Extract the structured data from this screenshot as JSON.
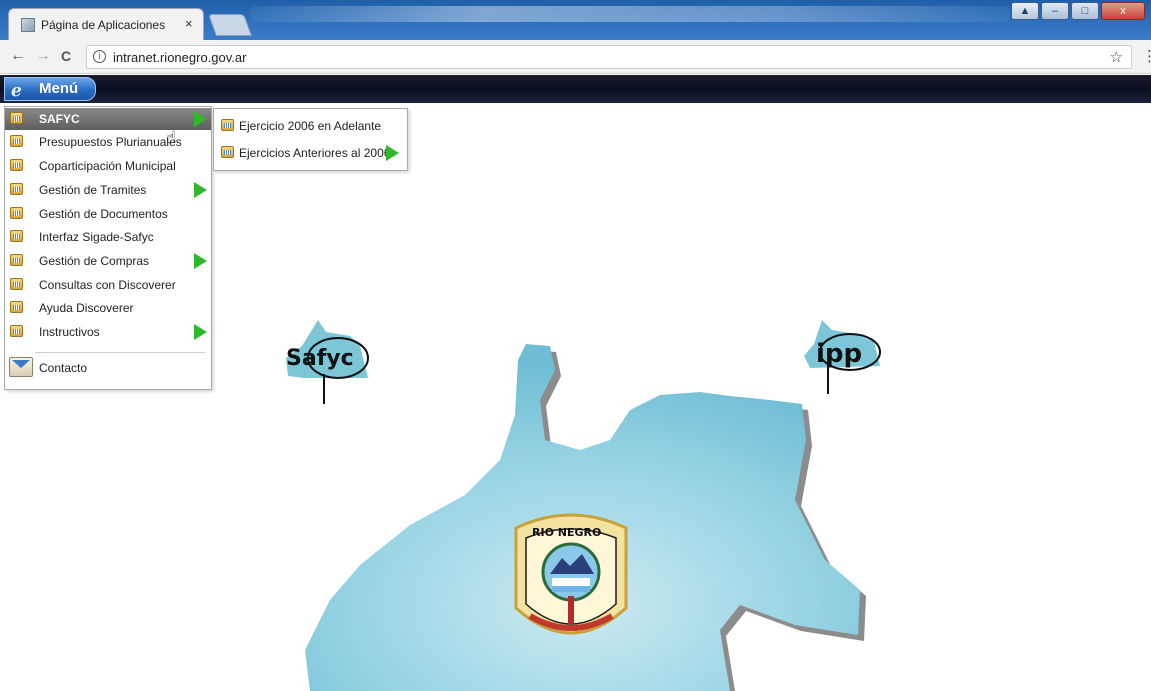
{
  "browser": {
    "tab_title": "Página de Aplicaciones",
    "tab_close": "×",
    "url": "intranet.rionegro.gov.ar",
    "back": "←",
    "forward": "→",
    "reload": "C",
    "info": "i",
    "star": "☆",
    "kebab": "⋮",
    "window_buttons": [
      "▲",
      "–",
      "□",
      "x"
    ]
  },
  "menubar": {
    "menu_label": "Menú"
  },
  "menu": {
    "items": [
      {
        "label": "SAFYC",
        "has_submenu": true,
        "active": true
      },
      {
        "label": "Presupuestos Plurianuales",
        "has_submenu": false
      },
      {
        "label": "Coparticipación Municipal",
        "has_submenu": false
      },
      {
        "label": "Gestión de Tramites",
        "has_submenu": true
      },
      {
        "label": "Gestión de Documentos",
        "has_submenu": false
      },
      {
        "label": "Interfaz Sigade-Safyc",
        "has_submenu": false
      },
      {
        "label": "Gestión de Compras",
        "has_submenu": true
      },
      {
        "label": "Consultas con Discoverer",
        "has_submenu": false
      },
      {
        "label": "Ayuda Discoverer",
        "has_submenu": false
      },
      {
        "label": "Instructivos",
        "has_submenu": true
      }
    ],
    "contact_label": "Contacto"
  },
  "submenu": {
    "items": [
      {
        "label": "Ejercicio 2006 en Adelante",
        "has_submenu": false
      },
      {
        "label": "Ejercicios Anteriores al 2006",
        "has_submenu": true
      }
    ]
  },
  "logos": {
    "safyc_text": "Safyc",
    "ipp_text": "ipp",
    "seal_text": "RIO NEGRO"
  },
  "colors": {
    "menubar": "#0c0f22",
    "menu_button": "#2a6bc4",
    "arrow": "#2fb82a",
    "map": "#8fcfe0"
  }
}
